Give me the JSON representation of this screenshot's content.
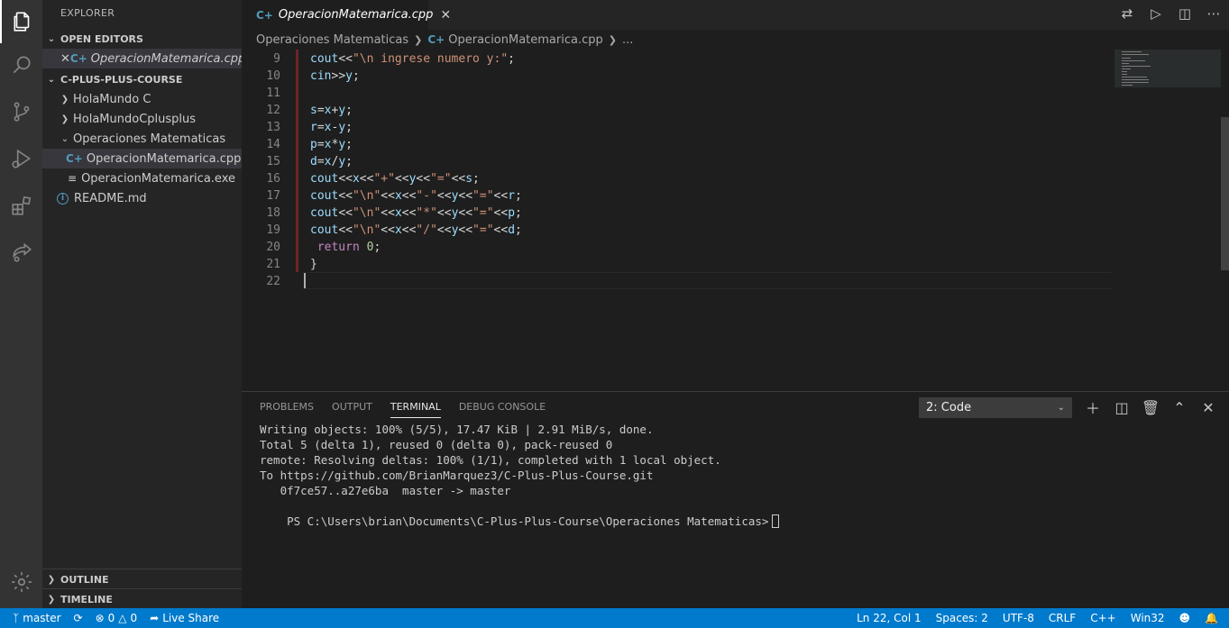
{
  "window": {
    "explorer_title": "EXPLORER"
  },
  "sidebar": {
    "open_editors": "OPEN EDITORS",
    "open_editor_file": "OperacionMatemarica.cpp",
    "open_editor_more": "...",
    "project": "C-PLUS-PLUS-COURSE",
    "items": [
      {
        "label": "HolaMundo C"
      },
      {
        "label": "HolaMundoCplusplus"
      },
      {
        "label": "Operaciones Matematicas"
      },
      {
        "label": "OperacionMatemarica.cpp"
      },
      {
        "label": "OperacionMatemarica.exe"
      },
      {
        "label": "README.md"
      }
    ],
    "outline": "OUTLINE",
    "timeline": "TIMELINE"
  },
  "tab": {
    "label": "OperacionMatemarica.cpp"
  },
  "breadcrumb": {
    "folder": "Operaciones Matematicas",
    "file": "OperacionMatemarica.cpp",
    "more": "..."
  },
  "editor": {
    "line_numbers": [
      "9",
      "10",
      "11",
      "12",
      "13",
      "14",
      "15",
      "16",
      "17",
      "18",
      "19",
      "20",
      "21",
      "22"
    ],
    "lines": [
      "cout<<\"\\n ingrese numero y:\";",
      "cin>>y;",
      "",
      "s=x+y;",
      "r=x-y;",
      "p=x*y;",
      "d=x/y;",
      "cout<<x<<\"+\"<<y<<\"=\"<<s;",
      "cout<<\"\\n\"<<x<<\"-\"<<y<<\"=\"<<r;",
      "cout<<\"\\n\"<<x<<\"*\"<<y<<\"=\"<<p;",
      "cout<<\"\\n\"<<x<<\"/\"<<y<<\"=\"<<d;",
      " return 0;",
      "}",
      ""
    ]
  },
  "panel": {
    "tabs": [
      {
        "label": "PROBLEMS"
      },
      {
        "label": "OUTPUT"
      },
      {
        "label": "TERMINAL"
      },
      {
        "label": "DEBUG CONSOLE"
      }
    ],
    "terminal_select": "2: Code",
    "terminal_lines": [
      "Writing objects: 100% (5/5), 17.47 KiB | 2.91 MiB/s, done.",
      "Total 5 (delta 1), reused 0 (delta 0), pack-reused 0",
      "remote: Resolving deltas: 100% (1/1), completed with 1 local object.",
      "To https://github.com/BrianMarquez3/C-Plus-Plus-Course.git",
      "   0f7ce57..a27e6ba  master -> master",
      "PS C:\\Users\\brian\\Documents\\C-Plus-Plus-Course\\Operaciones Matematicas>"
    ]
  },
  "statusbar": {
    "branch": "master",
    "errors": "0",
    "warnings": "0",
    "live_share": "Live Share",
    "position": "Ln 22, Col 1",
    "spaces": "Spaces: 2",
    "encoding": "UTF-8",
    "eol": "CRLF",
    "language": "C++",
    "platform": "Win32"
  },
  "colors": {
    "status_bar": "#007acc",
    "activity_bar": "#333333",
    "sidebar": "#252526",
    "editor": "#1e1e1e"
  }
}
